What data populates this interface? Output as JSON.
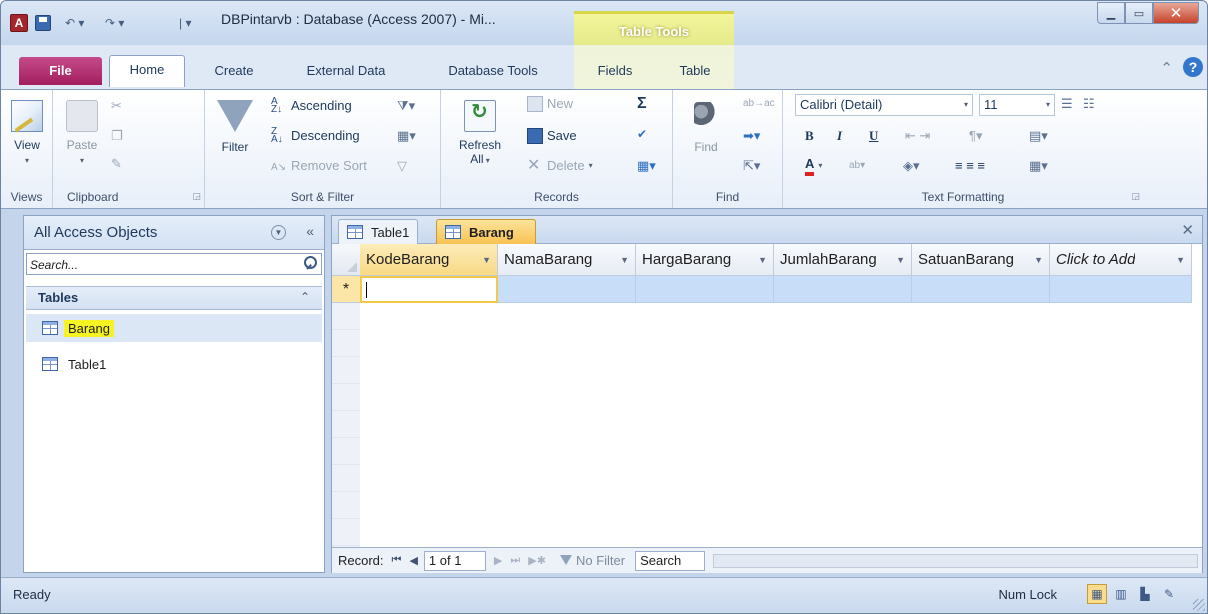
{
  "window": {
    "title": "DBPintarvb : Database (Access 2007) - Mi...",
    "context_tab_group": "Table Tools",
    "app_logo": "A",
    "buttons": [
      "minimize-icon",
      "maximize-icon",
      "close-icon"
    ]
  },
  "ribbon_tabs": [
    "File",
    "Home",
    "Create",
    "External Data",
    "Database Tools",
    "Fields",
    "Table"
  ],
  "ribbon": {
    "views": {
      "label": "Views",
      "view_btn": "View"
    },
    "clipboard": {
      "label": "Clipboard",
      "paste_btn": "Paste"
    },
    "sort_filter": {
      "label": "Sort & Filter",
      "filter_btn": "Filter",
      "ascending": "Ascending",
      "descending": "Descending",
      "remove_sort": "Remove Sort"
    },
    "records": {
      "label": "Records",
      "refresh_btn": "Refresh",
      "refresh_sub": "All",
      "new_btn": "New",
      "save_btn": "Save",
      "delete_btn": "Delete",
      "totals_glyph": "Σ"
    },
    "find": {
      "label": "Find",
      "find_btn": "Find"
    },
    "text_formatting": {
      "label": "Text Formatting",
      "font_name": "Calibri (Detail)",
      "font_size": "11",
      "bold": "B",
      "italic": "I",
      "underline": "U",
      "font_color_letter": "A"
    }
  },
  "nav_pane": {
    "title": "All Access Objects",
    "search_placeholder": "Search...",
    "group": "Tables",
    "items": [
      {
        "label": "Barang",
        "highlighted": true
      },
      {
        "label": "Table1",
        "highlighted": false
      }
    ]
  },
  "doc_tabs": [
    {
      "label": "Table1",
      "active": false
    },
    {
      "label": "Barang",
      "active": true
    }
  ],
  "datasheet": {
    "columns": [
      "KodeBarang",
      "NamaBarang",
      "HargaBarang",
      "JumlahBarang",
      "SatuanBarang",
      "Click to Add"
    ],
    "new_row_marker": "*"
  },
  "record_nav": {
    "record_label": "Record:",
    "position": "1 of 1",
    "filter_status": "No Filter",
    "search_label": "Search"
  },
  "status_bar": {
    "status": "Ready",
    "num_lock": "Num Lock"
  },
  "colors": {
    "file_tab": "#a31e5e",
    "context_tab": "#e5ea8a",
    "active_doc_tab": "#f8c254",
    "new_row": "#c8def8",
    "highlight": "#f6f322"
  }
}
